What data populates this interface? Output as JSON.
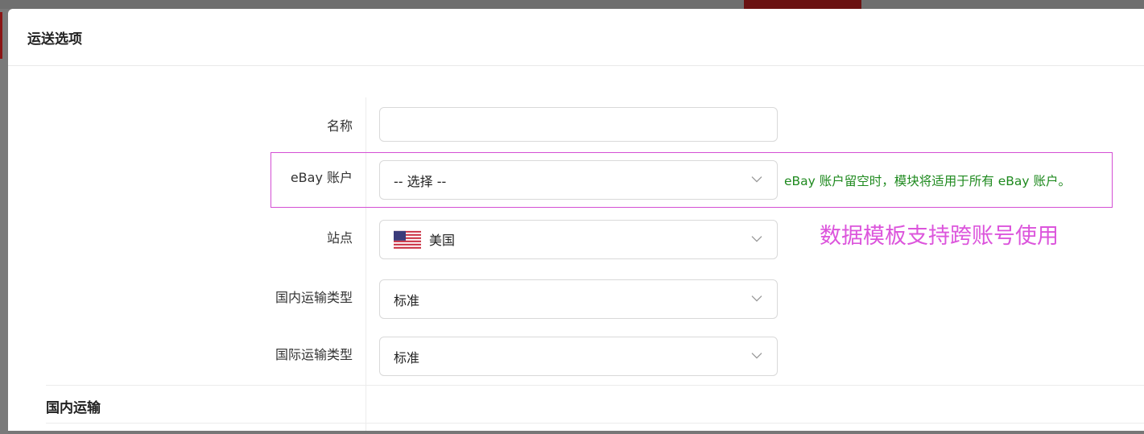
{
  "modal": {
    "title": "运送选项"
  },
  "form": {
    "name": {
      "label": "名称",
      "value": ""
    },
    "ebay_account": {
      "label": "eBay 账户",
      "selected": "-- 选择 --",
      "hint": "eBay 账户留空时，模块将适用于所有 eBay 账户。"
    },
    "site": {
      "label": "站点",
      "selected": "美国",
      "icon": "us-flag-icon"
    },
    "domestic_type": {
      "label": "国内运输类型",
      "selected": "标准"
    },
    "international_type": {
      "label": "国际运输类型",
      "selected": "标准"
    }
  },
  "annotation": {
    "text": "数据模板支持跨账号使用",
    "color": "#dc55dc",
    "box_color": "#d44fd4"
  },
  "sections": {
    "domestic_shipping": "国内运输"
  },
  "colors": {
    "hint_green": "#1f8a1f",
    "backdrop_accent": "#6a1212"
  }
}
